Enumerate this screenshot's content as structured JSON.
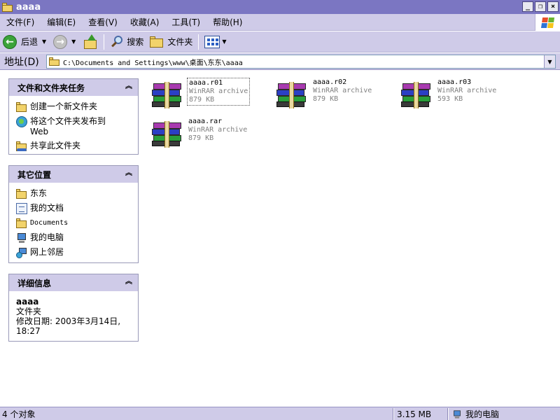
{
  "window": {
    "title": "aaaa"
  },
  "menu": {
    "items": [
      {
        "label": "文件(F)"
      },
      {
        "label": "编辑(E)"
      },
      {
        "label": "查看(V)"
      },
      {
        "label": "收藏(A)"
      },
      {
        "label": "工具(T)"
      },
      {
        "label": "帮助(H)"
      }
    ]
  },
  "toolbar": {
    "back_label": "后退",
    "search_label": "搜索",
    "folders_label": "文件夹"
  },
  "address": {
    "label": "地址(D)",
    "value": "C:\\Documents and Settings\\www\\桌面\\东东\\aaaa"
  },
  "tasks_panel": {
    "title": "文件和文件夹任务",
    "items": [
      {
        "label": "创建一个新文件夹",
        "icon": "new-folder-icon"
      },
      {
        "label": "将这个文件夹发布到Web",
        "icon": "publish-web-icon"
      },
      {
        "label": "共享此文件夹",
        "icon": "share-folder-icon"
      }
    ]
  },
  "places_panel": {
    "title": "其它位置",
    "items": [
      {
        "label": "东东",
        "icon": "folder-icon"
      },
      {
        "label": "我的文档",
        "icon": "my-documents-icon"
      },
      {
        "label": "Documents",
        "icon": "folder-icon"
      },
      {
        "label": "我的电脑",
        "icon": "my-computer-icon"
      },
      {
        "label": "网上邻居",
        "icon": "network-places-icon"
      }
    ]
  },
  "details_panel": {
    "title": "详细信息",
    "name": "aaaa",
    "type": "文件夹",
    "modified": "修改日期: 2003年3月14日, 18:27"
  },
  "files": [
    {
      "name": "aaaa.r01",
      "type": "WinRAR archive",
      "size": "879 KB",
      "selected": true
    },
    {
      "name": "aaaa.r02",
      "type": "WinRAR archive",
      "size": "879 KB",
      "selected": false
    },
    {
      "name": "aaaa.r03",
      "type": "WinRAR archive",
      "size": "593 KB",
      "selected": false
    },
    {
      "name": "aaaa.rar",
      "type": "WinRAR archive",
      "size": "879 KB",
      "selected": false
    }
  ],
  "status": {
    "count": "4 个对象",
    "total_size": "3.15 MB",
    "location": "我的电脑"
  }
}
